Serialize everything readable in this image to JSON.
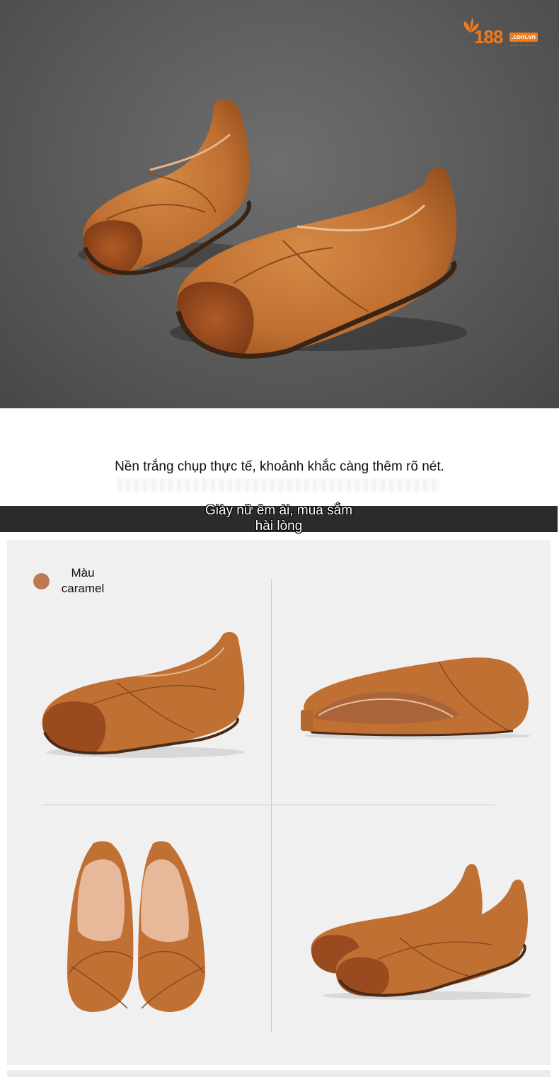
{
  "brand": {
    "number": "188",
    "domain": ".com.vn",
    "tagline": "mua là thích",
    "accent_color": "#f07a1c"
  },
  "caption": {
    "text": "Nền trắng chụp thực tế, khoảnh khắc càng thêm rõ nét."
  },
  "banner": {
    "line1": "Giày nữ êm ái, mua sắm",
    "line2": "hài lòng"
  },
  "color_option": {
    "label": "Màu caramel",
    "swatch_color": "#bd7a52"
  },
  "product": {
    "leather_color": "#c07032",
    "toe_color": "#9a4a1f",
    "sole_color": "#4a2a18"
  }
}
